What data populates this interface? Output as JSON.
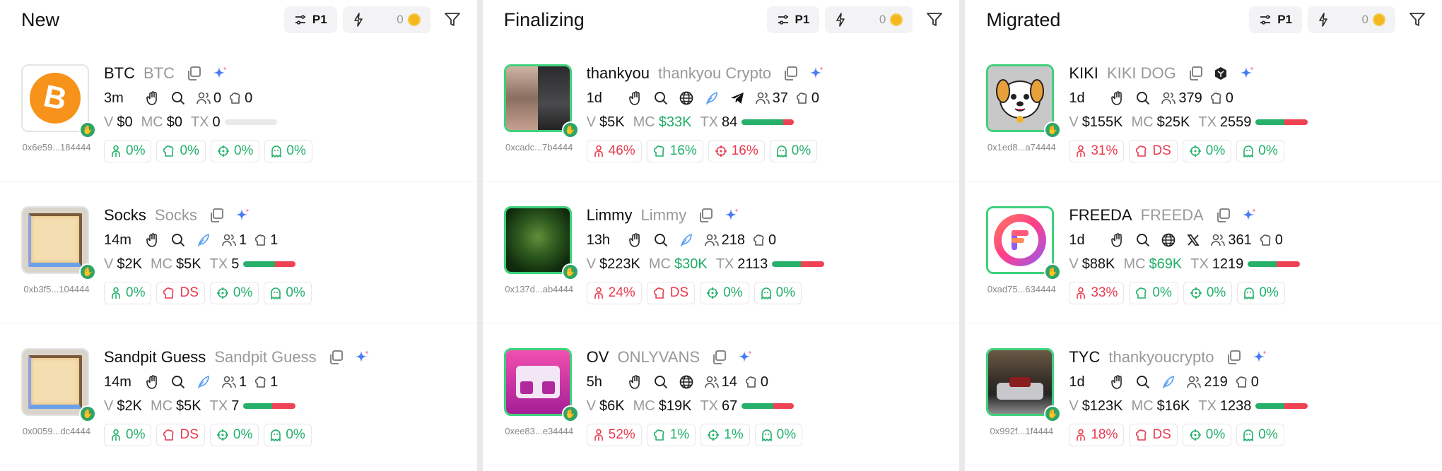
{
  "columns": [
    {
      "title": "New",
      "preset_label": "P1",
      "quickbuy_amount": "0",
      "cards": [
        {
          "ticker": "BTC",
          "name": "BTC",
          "age": "3m",
          "address": "0x6e59...184444",
          "holders": "0",
          "snipers": "0",
          "vol": "$0",
          "mc": "$0",
          "mc_green": false,
          "tx": "0",
          "bar_green": 0,
          "bar_red": 0,
          "icons": [
            "hand",
            "search"
          ],
          "top10": "0%",
          "dev": "0%",
          "insiders": "0%",
          "bundlers": "0%",
          "p1": "g",
          "p2": "g",
          "p3": "g",
          "p4": "g",
          "img": "btc"
        },
        {
          "ticker": "Socks",
          "name": "Socks",
          "age": "14m",
          "address": "0xb3f5...104444",
          "holders": "1",
          "snipers": "1",
          "vol": "$2K",
          "mc": "$5K",
          "mc_green": false,
          "tx": "5",
          "bar_green": 0.6,
          "bar_red": 0.4,
          "icons": [
            "hand",
            "search",
            "feather"
          ],
          "top10": "0%",
          "dev": "DS",
          "insiders": "0%",
          "bundlers": "0%",
          "p1": "g",
          "p2": "r",
          "p3": "g",
          "p4": "g",
          "img": "scroll"
        },
        {
          "ticker": "Sandpit Guess",
          "name": "Sandpit Guess",
          "age": "14m",
          "address": "0x0059...dc4444",
          "holders": "1",
          "snipers": "1",
          "vol": "$2K",
          "mc": "$5K",
          "mc_green": false,
          "tx": "7",
          "bar_green": 0.55,
          "bar_red": 0.45,
          "icons": [
            "hand",
            "search",
            "feather"
          ],
          "top10": "0%",
          "dev": "DS",
          "insiders": "0%",
          "bundlers": "0%",
          "p1": "g",
          "p2": "r",
          "p3": "g",
          "p4": "g",
          "img": "scroll"
        }
      ]
    },
    {
      "title": "Finalizing",
      "preset_label": "P1",
      "quickbuy_amount": "0",
      "cards": [
        {
          "ticker": "thankyou",
          "name": "thankyou Crypto",
          "age": "1d",
          "address": "0xcadc...7b4444",
          "holders": "37",
          "snipers": "0",
          "vol": "$5K",
          "mc": "$33K",
          "mc_green": true,
          "tx": "84",
          "bar_green": 0.8,
          "bar_red": 0.2,
          "icons": [
            "hand",
            "search",
            "globe",
            "feather",
            "telegram"
          ],
          "top10": "46%",
          "dev": "16%",
          "insiders": "16%",
          "bundlers": "0%",
          "p1": "r",
          "p2": "g",
          "p3": "r",
          "p4": "g",
          "img": "photo1"
        },
        {
          "ticker": "Limmy",
          "name": "Limmy",
          "age": "13h",
          "address": "0x137d...ab4444",
          "holders": "218",
          "snipers": "0",
          "vol": "$223K",
          "mc": "$30K",
          "mc_green": true,
          "tx": "2113",
          "bar_green": 0.55,
          "bar_red": 0.45,
          "icons": [
            "hand",
            "search",
            "feather"
          ],
          "top10": "24%",
          "dev": "DS",
          "insiders": "0%",
          "bundlers": "0%",
          "p1": "r",
          "p2": "r",
          "p3": "g",
          "p4": "g",
          "img": "face"
        },
        {
          "ticker": "OV",
          "name": "ONLYVANS",
          "age": "5h",
          "address": "0xee83...e34444",
          "holders": "14",
          "snipers": "0",
          "vol": "$6K",
          "mc": "$19K",
          "mc_green": false,
          "tx": "67",
          "bar_green": 0.6,
          "bar_red": 0.4,
          "icons": [
            "hand",
            "search",
            "globe"
          ],
          "top10": "52%",
          "dev": "1%",
          "insiders": "1%",
          "bundlers": "0%",
          "p1": "r",
          "p2": "g",
          "p3": "g",
          "p4": "g",
          "img": "ov"
        }
      ]
    },
    {
      "title": "Migrated",
      "preset_label": "P1",
      "quickbuy_amount": "0",
      "cards": [
        {
          "ticker": "KIKI",
          "name": "KIKI DOG",
          "age": "1d",
          "address": "0x1ed8...a74444",
          "holders": "379",
          "snipers": "0",
          "vol": "$155K",
          "mc": "$25K",
          "mc_green": false,
          "tx": "2559",
          "bar_green": 0.55,
          "bar_red": 0.45,
          "icons": [
            "hand",
            "search"
          ],
          "top10": "31%",
          "dev": "DS",
          "insiders": "0%",
          "bundlers": "0%",
          "p1": "r",
          "p2": "r",
          "p3": "g",
          "p4": "g",
          "img": "dog"
        },
        {
          "ticker": "FREEDA",
          "name": "FREEDA",
          "age": "1d",
          "address": "0xad75...634444",
          "holders": "361",
          "snipers": "0",
          "vol": "$88K",
          "mc": "$69K",
          "mc_green": true,
          "tx": "1219",
          "bar_green": 0.55,
          "bar_red": 0.45,
          "icons": [
            "hand",
            "search",
            "globe",
            "x"
          ],
          "top10": "33%",
          "dev": "0%",
          "insiders": "0%",
          "bundlers": "0%",
          "p1": "r",
          "p2": "g",
          "p3": "g",
          "p4": "g",
          "img": "freeda"
        },
        {
          "ticker": "TYC",
          "name": "thankyoucrypto",
          "age": "1d",
          "address": "0x992f...1f4444",
          "holders": "219",
          "snipers": "0",
          "vol": "$123K",
          "mc": "$16K",
          "mc_green": false,
          "tx": "1238",
          "bar_green": 0.55,
          "bar_red": 0.45,
          "icons": [
            "hand",
            "search",
            "feather"
          ],
          "top10": "18%",
          "dev": "DS",
          "insiders": "0%",
          "bundlers": "0%",
          "p1": "r",
          "p2": "r",
          "p3": "g",
          "p4": "g",
          "img": "car"
        }
      ]
    }
  ],
  "labels": {
    "v": "V",
    "mc": "MC",
    "tx": "TX"
  },
  "colors": {
    "green": "#22b06a",
    "red": "#e93a4f",
    "accent_star": "#4a7cf5"
  }
}
